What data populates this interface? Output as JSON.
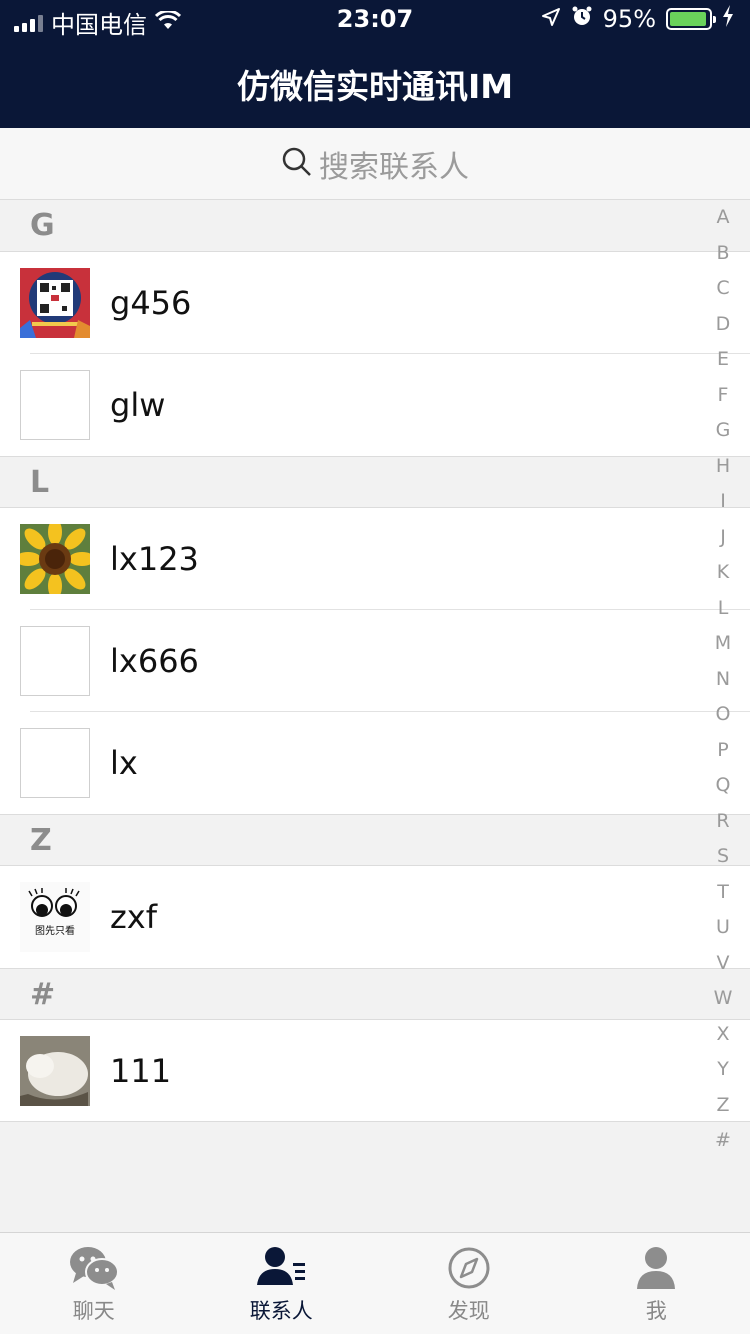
{
  "status_bar": {
    "carrier": "中国电信",
    "time": "23:07",
    "battery": "95%",
    "battery_level": 0.95
  },
  "nav": {
    "title": "仿微信实时通讯IM"
  },
  "search": {
    "placeholder": "搜索联系人"
  },
  "sections": [
    {
      "letter": "G",
      "contacts": [
        {
          "name": "g456",
          "avatar": "qr-code-image"
        },
        {
          "name": "glw",
          "avatar": "blank"
        }
      ]
    },
    {
      "letter": "L",
      "contacts": [
        {
          "name": "lx123",
          "avatar": "sunflower-image"
        },
        {
          "name": "lx666",
          "avatar": "blank"
        },
        {
          "name": "lx",
          "avatar": "blank"
        }
      ]
    },
    {
      "letter": "Z",
      "contacts": [
        {
          "name": "zxf",
          "avatar": "eyes-logo-image"
        }
      ]
    },
    {
      "letter": "#",
      "contacts": [
        {
          "name": "111",
          "avatar": "white-cat-image"
        }
      ]
    }
  ],
  "zxf_avatar_caption": "图先只看",
  "index_letters": [
    "A",
    "B",
    "C",
    "D",
    "E",
    "F",
    "G",
    "H",
    "I",
    "J",
    "K",
    "L",
    "M",
    "N",
    "O",
    "P",
    "Q",
    "R",
    "S",
    "T",
    "U",
    "V",
    "W",
    "X",
    "Y",
    "Z",
    "#"
  ],
  "tabs": [
    {
      "label": "聊天",
      "icon": "chat-bubbles-icon",
      "active": false
    },
    {
      "label": "联系人",
      "icon": "contacts-icon",
      "active": true
    },
    {
      "label": "发现",
      "icon": "compass-icon",
      "active": false
    },
    {
      "label": "我",
      "icon": "person-icon",
      "active": false
    }
  ],
  "colors": {
    "nav_bg": "#0a1737",
    "active_tab": "#0a1737",
    "battery": "#6ad25b"
  }
}
